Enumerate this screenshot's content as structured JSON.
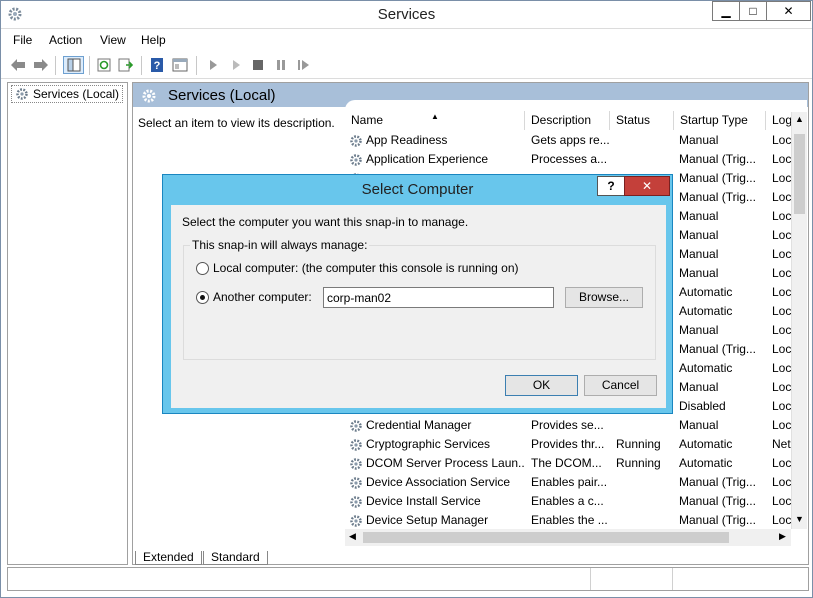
{
  "window": {
    "title": "Services",
    "icon": "gear-icon"
  },
  "menu": [
    "File",
    "Action",
    "View",
    "Help"
  ],
  "tree": {
    "root_label": "Services (Local)"
  },
  "right_pane": {
    "header": "Services (Local)",
    "description_hint": "Select an item to view its description."
  },
  "columns": [
    "Name",
    "Description",
    "Status",
    "Startup Type",
    "Log"
  ],
  "services": [
    {
      "name": "App Readiness",
      "description": "Gets apps re...",
      "status": "",
      "startup": "Manual",
      "log": "Loc"
    },
    {
      "name": "Application Experience",
      "description": "Processes a...",
      "status": "",
      "startup": "Manual (Trig...",
      "log": "Loc"
    },
    {
      "name": "",
      "description": "",
      "status": "",
      "startup": "Manual (Trig...",
      "log": "Loc"
    },
    {
      "name": "",
      "description": "",
      "status": "",
      "startup": "Manual (Trig...",
      "log": "Loc"
    },
    {
      "name": "",
      "description": "",
      "status": "",
      "startup": "Manual",
      "log": "Loc"
    },
    {
      "name": "",
      "description": "",
      "status": "",
      "startup": "Manual",
      "log": "Loc"
    },
    {
      "name": "",
      "description": "",
      "status": "",
      "startup": "Manual",
      "log": "Loc"
    },
    {
      "name": "",
      "description": "",
      "status": "",
      "startup": "Manual",
      "log": "Loc"
    },
    {
      "name": "",
      "description": "",
      "status": "",
      "startup": "Automatic",
      "log": "Loc"
    },
    {
      "name": "",
      "description": "",
      "status": "",
      "startup": "Automatic",
      "log": "Loc"
    },
    {
      "name": "",
      "description": "",
      "status": "",
      "startup": "Manual",
      "log": "Loc"
    },
    {
      "name": "",
      "description": "",
      "status": "",
      "startup": "Manual (Trig...",
      "log": "Loc"
    },
    {
      "name": "",
      "description": "",
      "status": "",
      "startup": "Automatic",
      "log": "Loc"
    },
    {
      "name": "",
      "description": "",
      "status": "",
      "startup": "Manual",
      "log": "Loc"
    },
    {
      "name": "",
      "description": "",
      "status": "",
      "startup": "Disabled",
      "log": "Loc"
    },
    {
      "name": "Credential Manager",
      "description": "Provides se...",
      "status": "",
      "startup": "Manual",
      "log": "Loc"
    },
    {
      "name": "Cryptographic Services",
      "description": "Provides thr...",
      "status": "Running",
      "startup": "Automatic",
      "log": "Net"
    },
    {
      "name": "DCOM Server Process Laun...",
      "description": "The DCOM...",
      "status": "Running",
      "startup": "Automatic",
      "log": "Loc"
    },
    {
      "name": "Device Association Service",
      "description": "Enables pair...",
      "status": "",
      "startup": "Manual (Trig...",
      "log": "Loc"
    },
    {
      "name": "Device Install Service",
      "description": "Enables a c...",
      "status": "",
      "startup": "Manual (Trig...",
      "log": "Loc"
    },
    {
      "name": "Device Setup Manager",
      "description": "Enables the ...",
      "status": "",
      "startup": "Manual (Trig...",
      "log": "Loc"
    }
  ],
  "tabs": [
    "Extended",
    "Standard"
  ],
  "dialog": {
    "title": "Select Computer",
    "help_label": "?",
    "close_label": "✕",
    "prompt": "Select the computer you want this snap-in to manage.",
    "group_label": "This snap-in will always manage:",
    "local_label": "Local computer:  (the computer this console is running on)",
    "another_label": "Another computer:",
    "computer_value": "corp-man02",
    "browse_label": "Browse...",
    "ok_label": "OK",
    "cancel_label": "Cancel"
  }
}
